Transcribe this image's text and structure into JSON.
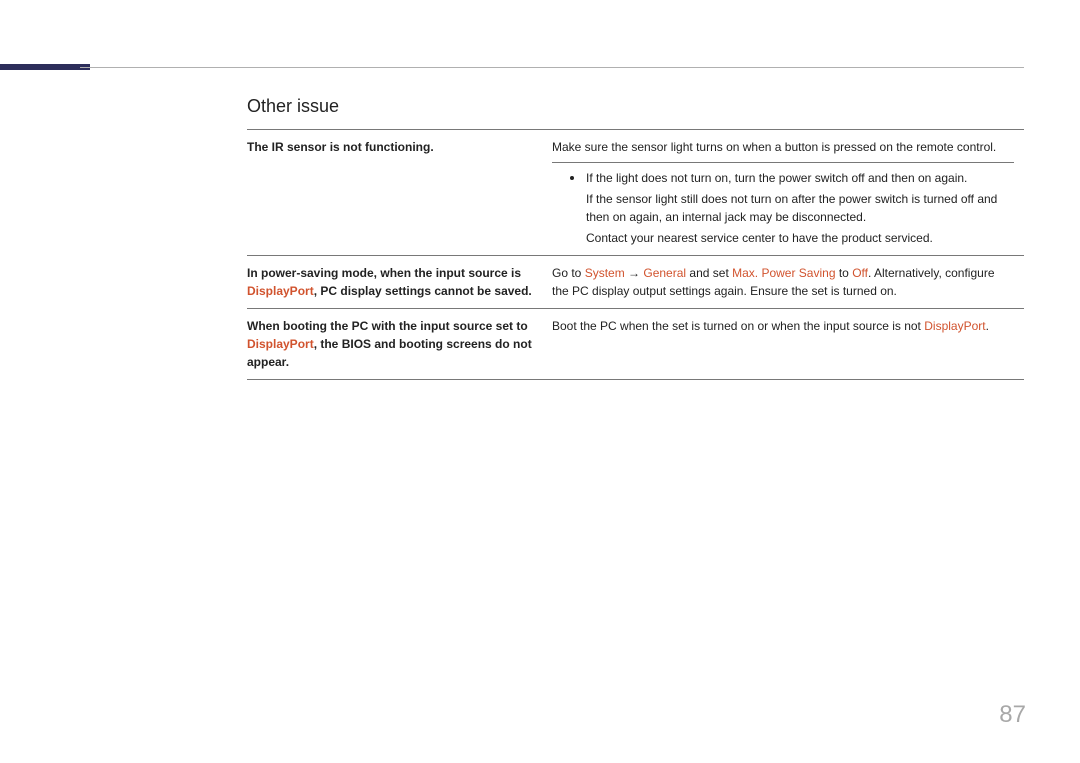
{
  "section": {
    "title": "Other issue"
  },
  "rows": [
    {
      "issue": {
        "pre": "The IR sensor is not functioning.",
        "menu": "",
        "post": ""
      },
      "solution": {
        "lead": "Make sure the sensor light turns on when a button is pressed on the remote control.",
        "bullet": "If the light does not turn on, turn the power switch off and then on again.",
        "after1": "If the sensor light still does not turn on after the power switch is turned off and then on again, an internal jack may be disconnected.",
        "after2": "Contact your nearest service center to have the product serviced."
      }
    },
    {
      "issue": {
        "pre": "In power-saving mode, when the input source is ",
        "menu": "DisplayPort",
        "post": ", PC display settings cannot be saved."
      },
      "solution": {
        "text_pre": "Go to ",
        "m1": "System",
        "arrow": " → ",
        "m2": "General",
        "mid1": " and set ",
        "m3": "Max. Power Saving",
        "mid2": " to ",
        "m4": "Off",
        "text_post": ". Alternatively, configure the PC display output settings again. Ensure the set is turned on."
      }
    },
    {
      "issue": {
        "pre": "When booting the PC with the input source set to ",
        "menu": "DisplayPort",
        "post": ", the BIOS and booting screens do not appear."
      },
      "solution": {
        "text_pre": "Boot the PC when the set is turned on or when the input source is not ",
        "m1": "DisplayPort",
        "text_post": "."
      }
    }
  ],
  "page_number": "87"
}
